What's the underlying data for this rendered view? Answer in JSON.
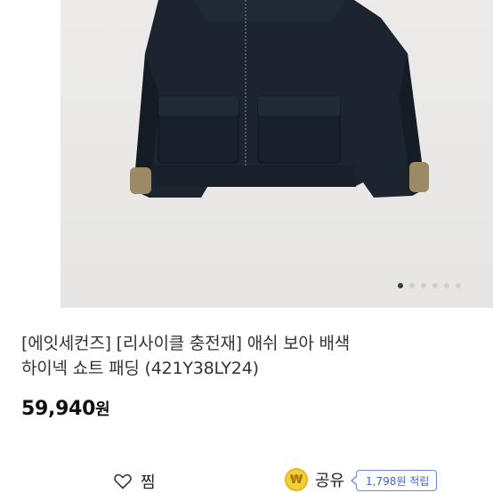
{
  "product": {
    "title_line1": "[에잇세컨즈] [리사이클 충전재] 애쉬 보아 배색",
    "title_line2": "하이넥 쇼트 패딩 (421Y38LY24)",
    "price_amount": "59,940",
    "price_unit": "원",
    "image_alt": "navy padded jacket with boa cuffs"
  },
  "gallery": {
    "slide_count": 6,
    "active_slide": 1
  },
  "actions": {
    "wish_label": "찜",
    "share_label": "공유",
    "coin_symbol": "₩",
    "reward_text": "1,798원 적립"
  },
  "colors": {
    "jacket": "#1c2430",
    "boa": "#9c8a63",
    "coin": "#f3cf3a",
    "reward_border": "#6a8ad6"
  }
}
